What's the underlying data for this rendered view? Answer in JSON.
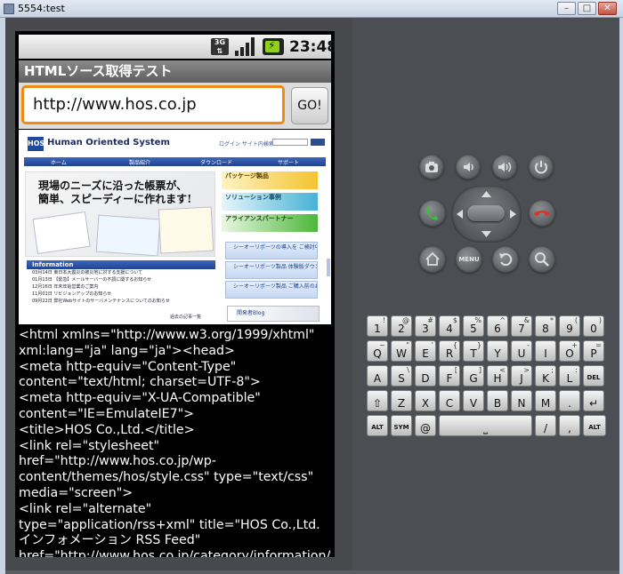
{
  "window": {
    "title": "5554:test",
    "buttons": {
      "minimize": "–",
      "maximize": "□",
      "close": "✕"
    }
  },
  "statusbar": {
    "network": "3G",
    "time": "23:48"
  },
  "app": {
    "title": "HTMLソース取得テスト",
    "url_value": "http://www.hos.co.jp",
    "go_label": "GO!"
  },
  "webpage": {
    "logo": "HOS",
    "brand": "Human Oriented System",
    "login": "ログイン   サイト内検索",
    "nav": [
      "ホーム",
      "製品紹介",
      "ダウンロード",
      "サポート"
    ],
    "slogan_line1": "現場のニーズに沿った帳票が、",
    "slogan_line2": "簡単、スピーディーに作れます!",
    "side_buttons": [
      "パッケージ製品",
      "ソリューション事例",
      "アライアンスパートナー"
    ],
    "side_links": [
      "シーオーリポーツの導入を\nご検討中のお客様へ",
      "シーオーリポーツ製品\n体験版ダウンロード",
      "シーオーリポーツ製品\nご購入前のお客様へ"
    ],
    "info_header": "Information",
    "info_rows": [
      "03月14日  東日本大震災の被災地に対する支援について",
      "01月13日  【緊急】メールサーバーの不調に関するお知らせ",
      "12月16日  年末年始営業のご案内",
      "11月01日  リビジョンアップのお知らせ",
      "09月22日  弊社Webサイトのサーバメンテナンスについてのお知らせ"
    ],
    "more": "過去の記事一覧",
    "blog": "開発者Blog"
  },
  "source_text": "<html xmlns=\"http://www.w3.org/1999/xhtml\" xml:lang=\"ja\" lang=\"ja\"><head>\n<meta http-equiv=\"Content-Type\" content=\"text/html; charset=UTF-8\">\n<meta http-equiv=\"X-UA-Compatible\" content=\"IE=EmulateIE7\">\n<title>HOS Co.,Ltd.</title>\n<link rel=\"stylesheet\" href=\"http://www.hos.co.jp/wp-content/themes/hos/style.css\" type=\"text/css\" media=\"screen\">\n<link rel=\"alternate\" type=\"application/rss+xml\" title=\"HOS Co.,Ltd. インフォメーション RSS Feed\" href=\"http://www.hos.co.jp/category/information/feed/\">\n<link rel=\"alternate\" type=\"application/atom+xml\"",
  "controls": {
    "menu_label": "MENU"
  },
  "keyboard": {
    "row1": [
      [
        "1",
        "!"
      ],
      [
        "2",
        "@"
      ],
      [
        "3",
        "#"
      ],
      [
        "4",
        "$"
      ],
      [
        "5",
        "%"
      ],
      [
        "6",
        "^"
      ],
      [
        "7",
        "&"
      ],
      [
        "8",
        "*"
      ],
      [
        "9",
        "("
      ],
      [
        "0",
        ")"
      ]
    ],
    "row2": [
      [
        "Q",
        "~"
      ],
      [
        "W",
        "\""
      ],
      [
        "E",
        "'"
      ],
      [
        "R",
        "{"
      ],
      [
        "T",
        "}"
      ],
      [
        "Y",
        ""
      ],
      [
        "U",
        "-"
      ],
      [
        "I",
        ""
      ],
      [
        "O",
        "+"
      ],
      [
        "P",
        "="
      ]
    ],
    "row3": [
      [
        "A",
        ""
      ],
      [
        "S",
        "\\"
      ],
      [
        "D",
        ""
      ],
      [
        "F",
        "["
      ],
      [
        "G",
        "]"
      ],
      [
        "H",
        "<"
      ],
      [
        "J",
        ">"
      ],
      [
        "K",
        ";"
      ],
      [
        "L",
        ":"
      ],
      [
        "DEL",
        ""
      ]
    ],
    "row4": [
      [
        "⇧",
        ""
      ],
      [
        "Z",
        ""
      ],
      [
        "X",
        ""
      ],
      [
        "C",
        ""
      ],
      [
        "V",
        ""
      ],
      [
        "B",
        ""
      ],
      [
        "N",
        ""
      ],
      [
        "M",
        ""
      ],
      [
        ".",
        ""
      ],
      [
        "↵",
        ""
      ]
    ],
    "alt_left": "ALT",
    "sym": "SYM",
    "at": "@",
    "space": "⎵",
    "slash": "/",
    "comma_q": ",",
    "alt_right": "ALT"
  }
}
